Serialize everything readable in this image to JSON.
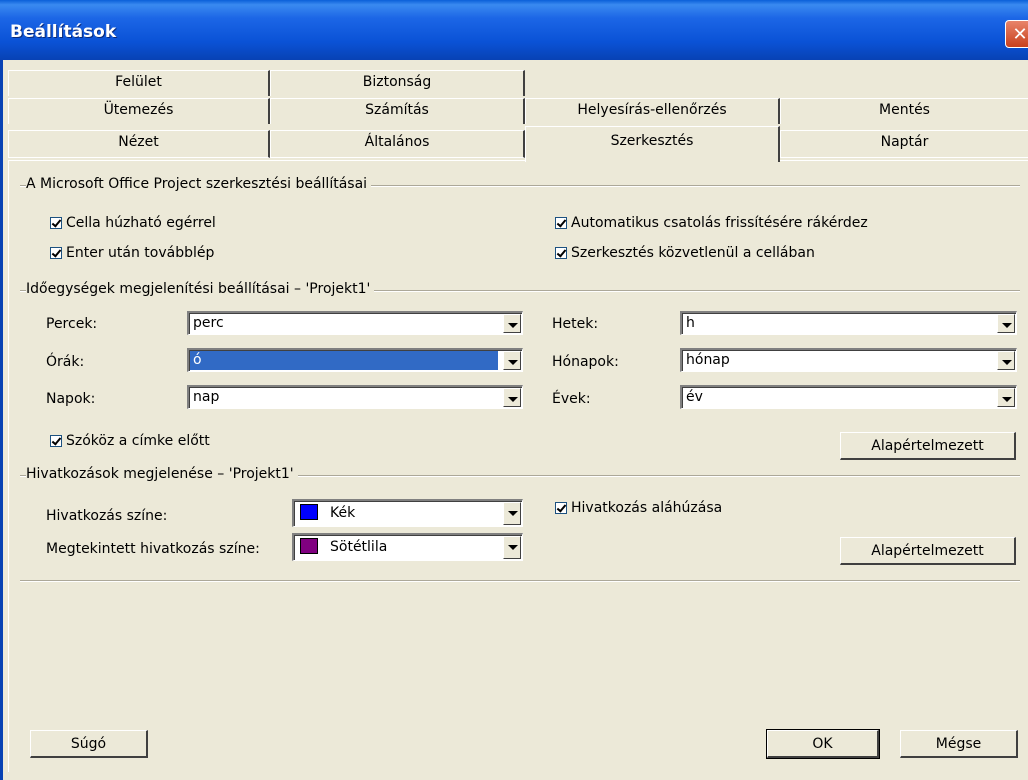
{
  "window": {
    "title": "Beállítások",
    "close_label": "✕"
  },
  "tabs": {
    "row1": [
      {
        "label": "Felület"
      },
      {
        "label": "Biztonság"
      }
    ],
    "row2": [
      {
        "label": "Ütemezés"
      },
      {
        "label": "Számítás"
      },
      {
        "label": "Helyesírás-ellenőrzés"
      },
      {
        "label": "Mentés"
      }
    ],
    "row3": [
      {
        "label": "Nézet"
      },
      {
        "label": "Általános"
      },
      {
        "label": "Szerkesztés",
        "selected": true
      },
      {
        "label": "Naptár"
      }
    ]
  },
  "editing": {
    "group_title": "A Microsoft Office Project szerkesztési beállításai",
    "cell_drag": {
      "label": "Cella húzható egérrel",
      "checked": true
    },
    "enter_move": {
      "label": "Enter után továbblép",
      "checked": true
    },
    "auto_link": {
      "label": "Automatikus csatolás frissítésére rákérdez",
      "checked": true
    },
    "edit_in_cell": {
      "label": "Szerkesztés közvetlenül a cellában",
      "checked": true
    }
  },
  "time_units": {
    "group_title": "Időegységek megjelenítési beállításai – 'Projekt1'",
    "minutes": {
      "label": "Percek:",
      "value": "perc"
    },
    "hours": {
      "label": "Órák:",
      "value": "ó"
    },
    "days": {
      "label": "Napok:",
      "value": "nap"
    },
    "weeks": {
      "label": "Hetek:",
      "value": "h"
    },
    "months": {
      "label": "Hónapok:",
      "value": "hónap"
    },
    "years": {
      "label": "Évek:",
      "value": "év"
    },
    "space_before_label": {
      "label": "Szóköz a címke előtt",
      "checked": true
    },
    "default_button": "Alapértelmezett"
  },
  "hyperlinks": {
    "group_title": "Hivatkozások megjelenése – 'Projekt1'",
    "color": {
      "label": "Hivatkozás színe:",
      "value": "Kék",
      "swatch": "#0000ff"
    },
    "visited_color": {
      "label": "Megtekintett hivatkozás színe:",
      "value": "Sötétlila",
      "swatch": "#800080"
    },
    "underline": {
      "label": "Hivatkozás aláhúzása",
      "checked": true
    },
    "default_button": "Alapértelmezett"
  },
  "footer": {
    "help": "Súgó",
    "ok": "OK",
    "cancel": "Mégse"
  }
}
